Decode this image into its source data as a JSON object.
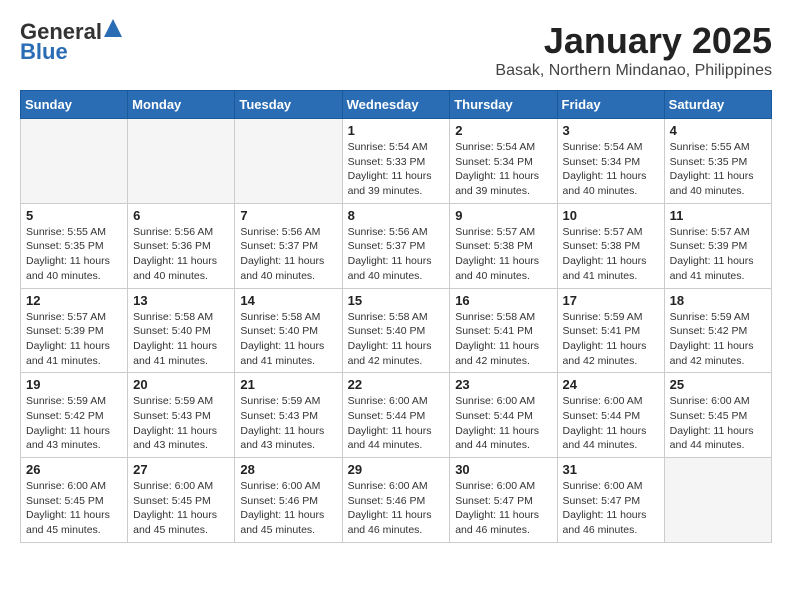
{
  "header": {
    "logo_general": "General",
    "logo_blue": "Blue",
    "month_title": "January 2025",
    "location": "Basak, Northern Mindanao, Philippines"
  },
  "weekdays": [
    "Sunday",
    "Monday",
    "Tuesday",
    "Wednesday",
    "Thursday",
    "Friday",
    "Saturday"
  ],
  "weeks": [
    [
      {
        "day": "",
        "info": ""
      },
      {
        "day": "",
        "info": ""
      },
      {
        "day": "",
        "info": ""
      },
      {
        "day": "1",
        "info": "Sunrise: 5:54 AM\nSunset: 5:33 PM\nDaylight: 11 hours and 39 minutes."
      },
      {
        "day": "2",
        "info": "Sunrise: 5:54 AM\nSunset: 5:34 PM\nDaylight: 11 hours and 39 minutes."
      },
      {
        "day": "3",
        "info": "Sunrise: 5:54 AM\nSunset: 5:34 PM\nDaylight: 11 hours and 40 minutes."
      },
      {
        "day": "4",
        "info": "Sunrise: 5:55 AM\nSunset: 5:35 PM\nDaylight: 11 hours and 40 minutes."
      }
    ],
    [
      {
        "day": "5",
        "info": "Sunrise: 5:55 AM\nSunset: 5:35 PM\nDaylight: 11 hours and 40 minutes."
      },
      {
        "day": "6",
        "info": "Sunrise: 5:56 AM\nSunset: 5:36 PM\nDaylight: 11 hours and 40 minutes."
      },
      {
        "day": "7",
        "info": "Sunrise: 5:56 AM\nSunset: 5:37 PM\nDaylight: 11 hours and 40 minutes."
      },
      {
        "day": "8",
        "info": "Sunrise: 5:56 AM\nSunset: 5:37 PM\nDaylight: 11 hours and 40 minutes."
      },
      {
        "day": "9",
        "info": "Sunrise: 5:57 AM\nSunset: 5:38 PM\nDaylight: 11 hours and 40 minutes."
      },
      {
        "day": "10",
        "info": "Sunrise: 5:57 AM\nSunset: 5:38 PM\nDaylight: 11 hours and 41 minutes."
      },
      {
        "day": "11",
        "info": "Sunrise: 5:57 AM\nSunset: 5:39 PM\nDaylight: 11 hours and 41 minutes."
      }
    ],
    [
      {
        "day": "12",
        "info": "Sunrise: 5:57 AM\nSunset: 5:39 PM\nDaylight: 11 hours and 41 minutes."
      },
      {
        "day": "13",
        "info": "Sunrise: 5:58 AM\nSunset: 5:40 PM\nDaylight: 11 hours and 41 minutes."
      },
      {
        "day": "14",
        "info": "Sunrise: 5:58 AM\nSunset: 5:40 PM\nDaylight: 11 hours and 41 minutes."
      },
      {
        "day": "15",
        "info": "Sunrise: 5:58 AM\nSunset: 5:40 PM\nDaylight: 11 hours and 42 minutes."
      },
      {
        "day": "16",
        "info": "Sunrise: 5:58 AM\nSunset: 5:41 PM\nDaylight: 11 hours and 42 minutes."
      },
      {
        "day": "17",
        "info": "Sunrise: 5:59 AM\nSunset: 5:41 PM\nDaylight: 11 hours and 42 minutes."
      },
      {
        "day": "18",
        "info": "Sunrise: 5:59 AM\nSunset: 5:42 PM\nDaylight: 11 hours and 42 minutes."
      }
    ],
    [
      {
        "day": "19",
        "info": "Sunrise: 5:59 AM\nSunset: 5:42 PM\nDaylight: 11 hours and 43 minutes."
      },
      {
        "day": "20",
        "info": "Sunrise: 5:59 AM\nSunset: 5:43 PM\nDaylight: 11 hours and 43 minutes."
      },
      {
        "day": "21",
        "info": "Sunrise: 5:59 AM\nSunset: 5:43 PM\nDaylight: 11 hours and 43 minutes."
      },
      {
        "day": "22",
        "info": "Sunrise: 6:00 AM\nSunset: 5:44 PM\nDaylight: 11 hours and 44 minutes."
      },
      {
        "day": "23",
        "info": "Sunrise: 6:00 AM\nSunset: 5:44 PM\nDaylight: 11 hours and 44 minutes."
      },
      {
        "day": "24",
        "info": "Sunrise: 6:00 AM\nSunset: 5:44 PM\nDaylight: 11 hours and 44 minutes."
      },
      {
        "day": "25",
        "info": "Sunrise: 6:00 AM\nSunset: 5:45 PM\nDaylight: 11 hours and 44 minutes."
      }
    ],
    [
      {
        "day": "26",
        "info": "Sunrise: 6:00 AM\nSunset: 5:45 PM\nDaylight: 11 hours and 45 minutes."
      },
      {
        "day": "27",
        "info": "Sunrise: 6:00 AM\nSunset: 5:45 PM\nDaylight: 11 hours and 45 minutes."
      },
      {
        "day": "28",
        "info": "Sunrise: 6:00 AM\nSunset: 5:46 PM\nDaylight: 11 hours and 45 minutes."
      },
      {
        "day": "29",
        "info": "Sunrise: 6:00 AM\nSunset: 5:46 PM\nDaylight: 11 hours and 46 minutes."
      },
      {
        "day": "30",
        "info": "Sunrise: 6:00 AM\nSunset: 5:47 PM\nDaylight: 11 hours and 46 minutes."
      },
      {
        "day": "31",
        "info": "Sunrise: 6:00 AM\nSunset: 5:47 PM\nDaylight: 11 hours and 46 minutes."
      },
      {
        "day": "",
        "info": ""
      }
    ]
  ]
}
